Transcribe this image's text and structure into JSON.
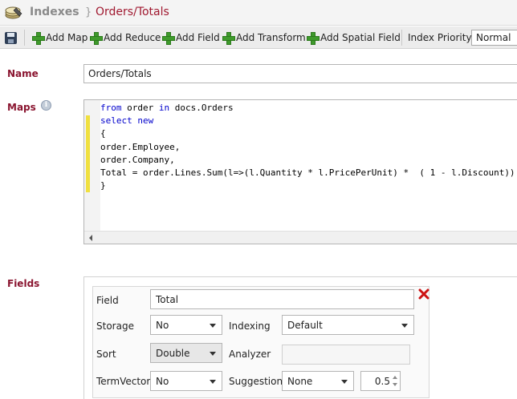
{
  "header": {
    "icon": "database-icon",
    "root": "Indexes",
    "separator": "}",
    "current": "Orders/Totals"
  },
  "toolbar": {
    "save_icon": "floppy-disk-icon",
    "add_map": "Add Map",
    "add_reduce": "Add Reduce",
    "add_field": "Add Field",
    "add_transform": "Add Transform",
    "add_spatial_field": "Add Spatial Field",
    "priority_label": "Index Priority",
    "priority_value": "Normal"
  },
  "form": {
    "name_label": "Name",
    "name_value": "Orders/Totals",
    "maps_label": "Maps",
    "maps_info_icon": "info-icon",
    "fields_label": "Fields"
  },
  "editor": {
    "lines": [
      [
        {
          "t": "from",
          "kw": true
        },
        {
          "t": " order "
        },
        {
          "t": "in",
          "kw": true
        },
        {
          "t": " docs.Orders"
        }
      ],
      [
        {
          "t": "select",
          "kw": true
        },
        {
          "t": " "
        },
        {
          "t": "new",
          "kw": true
        }
      ],
      [
        {
          "t": "{"
        }
      ],
      [
        {
          "t": "order.Employee,"
        }
      ],
      [
        {
          "t": "order.Company,"
        }
      ],
      [
        {
          "t": "Total = order.Lines.Sum(l=>(l.Quantity * l.PricePerUnit) *  ( 1 - l.Discount))"
        }
      ],
      [
        {
          "t": "}"
        }
      ]
    ]
  },
  "field": {
    "field_label": "Field",
    "field_value": "Total",
    "storage_label": "Storage",
    "storage_value": "No",
    "indexing_label": "Indexing",
    "indexing_value": "Default",
    "sort_label": "Sort",
    "sort_value": "Double",
    "analyzer_label": "Analyzer",
    "analyzer_value": "",
    "termvector_label": "TermVector",
    "termvector_value": "No",
    "suggestion_label": "Suggestion",
    "suggestion_value": "None",
    "suggestion_accuracy": "0.5",
    "remove_icon": "close-icon"
  },
  "colors": {
    "accent": "#8a1530",
    "keyword": "#0000cc",
    "add_icon": "#3f9a2c",
    "change_marker": "#f0e040"
  }
}
